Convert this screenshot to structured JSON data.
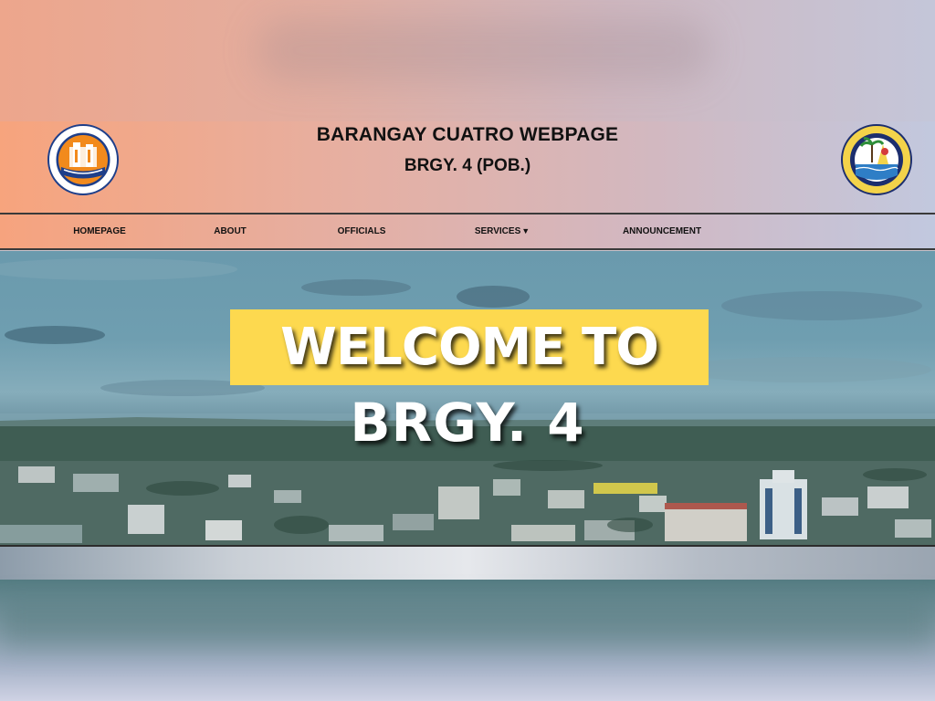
{
  "header": {
    "title": "BARANGAY CUATRO WEBPAGE",
    "subtitle": "BRGY. 4 (POB.)",
    "left_logo": {
      "icon": "barangay-seal-icon",
      "ring_text": "SANGGUNIANG BARANGAY · BRGY. IV, LUCENA CITY"
    },
    "right_logo": {
      "icon": "city-seal-icon",
      "ring_text": "CITY OF LUCENA · OFFICIAL SEAL"
    }
  },
  "nav": {
    "items": [
      {
        "label": "HOMEPAGE"
      },
      {
        "label": "ABOUT"
      },
      {
        "label": "OFFICIALS"
      },
      {
        "label": "SERVICES",
        "caret": "▼"
      },
      {
        "label": "ANNOUNCEMENT"
      }
    ]
  },
  "hero": {
    "line1": "WELCOME TO",
    "line2": "BRGY. 4"
  },
  "colors": {
    "banner_yellow": "#fdd94f",
    "header_gradient_start": "#f7a47d",
    "header_gradient_end": "#c2c8de",
    "text_dark": "#111111"
  }
}
